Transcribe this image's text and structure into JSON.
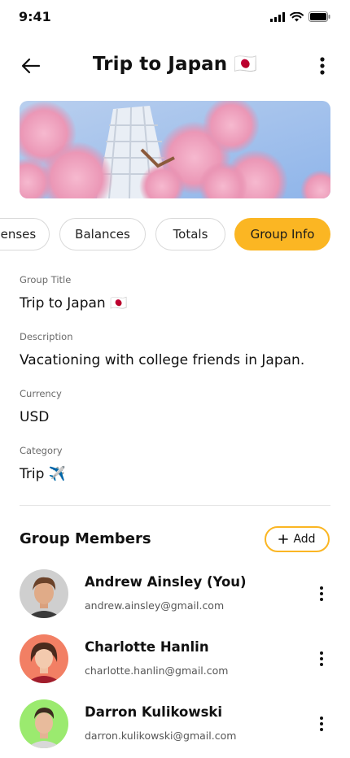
{
  "status": {
    "time": "9:41"
  },
  "header": {
    "title": "Trip to Japan 🇯🇵"
  },
  "tabs": [
    {
      "label": "Expenses"
    },
    {
      "label": "Balances"
    },
    {
      "label": "Totals"
    },
    {
      "label": "Group Info",
      "active": true
    }
  ],
  "group_info": {
    "title_label": "Group Title",
    "title_value": "Trip to Japan 🇯🇵",
    "description_label": "Description",
    "description_value": "Vacationing with college friends in Japan.",
    "currency_label": "Currency",
    "currency_value": "USD",
    "category_label": "Category",
    "category_value": "Trip ✈️"
  },
  "members_section": {
    "title": "Group Members",
    "add_label": "Add"
  },
  "members": [
    {
      "name": "Andrew Ainsley (You)",
      "email": "andrew.ainsley@gmail.com",
      "avatar_bg": "#cfcfcf"
    },
    {
      "name": "Charlotte Hanlin",
      "email": "charlotte.hanlin@gmail.com",
      "avatar_bg": "#f27f64"
    },
    {
      "name": "Darron Kulikowski",
      "email": "darron.kulikowski@gmail.com",
      "avatar_bg": "#9bea6f"
    }
  ],
  "colors": {
    "accent": "#fbb623"
  }
}
